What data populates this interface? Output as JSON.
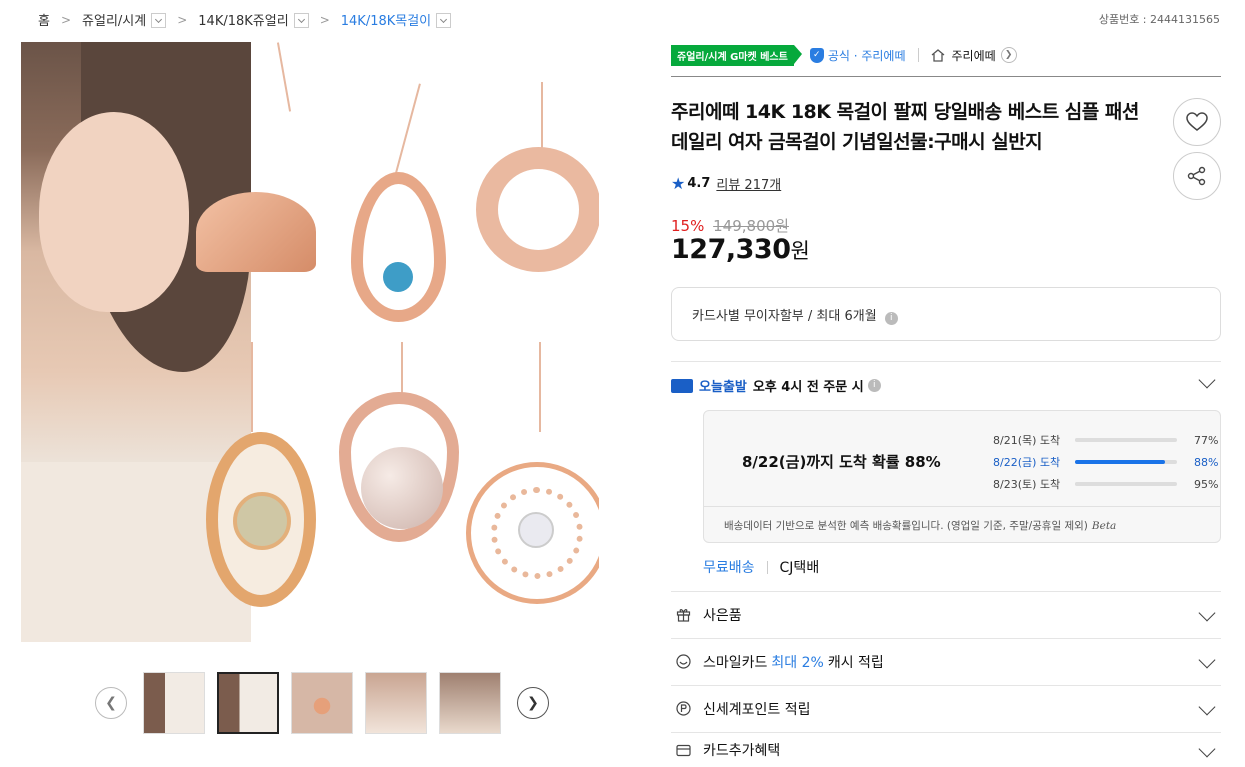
{
  "breadcrumb": {
    "home": "홈",
    "level1": "쥬얼리/시계",
    "level2": "14K/18K쥬얼리",
    "level3": "14K/18K목걸이"
  },
  "product_no": "상품번호 : 2444131565",
  "badges": {
    "best": "쥬얼리/시계 G마켓 베스트",
    "official": "공식 · 주리에떼",
    "shop": "주리에떼"
  },
  "title": "주리에떼 14K 18K 목걸이 팔찌 당일배송 베스트 심플 패션 데일리 여자 금목걸이 기념일선물:구매시 실반지",
  "rating": {
    "score": "4.7",
    "reviews": "리뷰 217개"
  },
  "price": {
    "discount": "15%",
    "original": "149,800원",
    "sale": "127,330",
    "unit": "원"
  },
  "card_installment": "카드사별 무이자할부 / 최대 6개월",
  "shipping": {
    "today_label": "오늘출발",
    "cutoff": "오후 4시 전 주문 시",
    "headline": "8/22(금)까지 도착 확률 88%",
    "rows": [
      {
        "date": "8/21(목) 도착",
        "pct": "77%",
        "value": 77
      },
      {
        "date": "8/22(금) 도착",
        "pct": "88%",
        "value": 88
      },
      {
        "date": "8/23(토) 도착",
        "pct": "95%",
        "value": 95
      }
    ],
    "note": "배송데이터 기반으로 분석한 예측 배송확률입니다. (영업일 기준, 주말/공휴일 제외)",
    "beta": "Beta",
    "free": "무료배송",
    "carrier": "CJ택배"
  },
  "accordions": {
    "gift": "사은품",
    "smile_pre": "스마일카드",
    "smile_hl": "최대 2%",
    "smile_post": "캐시 적립",
    "shinsegae": "신세계포인트 적립",
    "card_benefit": "카드추가혜택"
  },
  "colors": {
    "accent": "#2a7de1",
    "discount": "#e02020",
    "best_green": "#06a93c"
  },
  "icons": [
    "heart-icon",
    "share-icon",
    "star-icon",
    "gift-icon",
    "smile-icon",
    "point-icon",
    "card-icon",
    "chevron-down-icon",
    "truck-icon",
    "info-icon"
  ]
}
